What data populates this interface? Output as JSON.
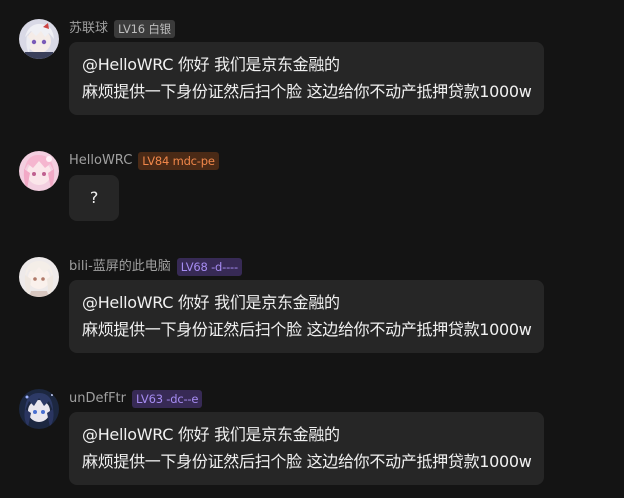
{
  "messages": [
    {
      "username": "苏联球",
      "badge": "LV16 白银",
      "lines": [
        "@HelloWRC 你好 我们是京东金融的",
        "麻烦提供一下身份证然后扫个脸 这边给你不动产抵押贷款1000w"
      ]
    },
    {
      "username": "HelloWRC",
      "badge": "LV84 mdc-pe",
      "lines": [
        "?"
      ]
    },
    {
      "username": "bili-蓝屏的此电脑",
      "badge": "LV68 -d----",
      "lines": [
        "@HelloWRC 你好 我们是京东金融的",
        "麻烦提供一下身份证然后扫个脸 这边给你不动产抵押贷款1000w"
      ]
    },
    {
      "username": "unDefFtr",
      "badge": "LV63 -dc--e",
      "lines": [
        "@HelloWRC 你好 我们是京东金融的",
        "麻烦提供一下身份证然后扫个脸 这边给你不动产抵押贷款1000w"
      ]
    }
  ],
  "colors": {
    "background": "#141414",
    "bubble": "#262626",
    "badge_gray": "#bdbdbd",
    "badge_orange": "#f0874a",
    "badge_purple": "#a68cf2"
  }
}
